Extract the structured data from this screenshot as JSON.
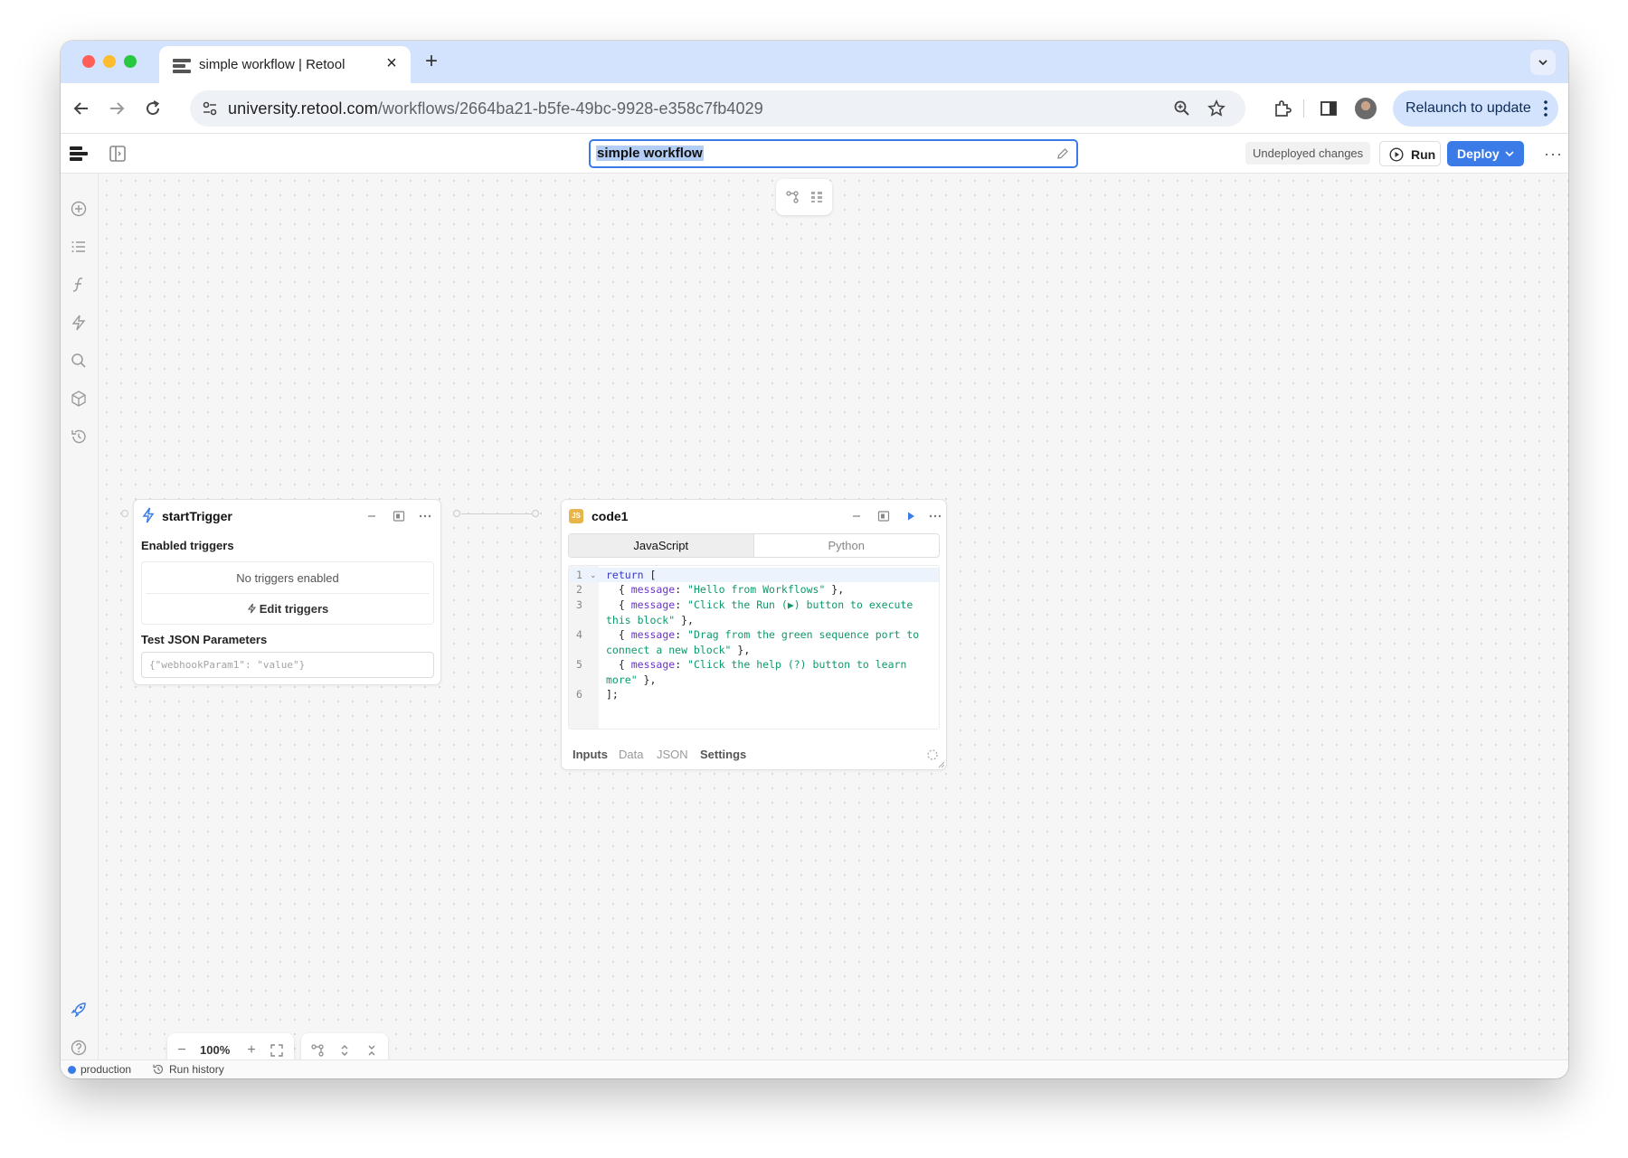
{
  "browser": {
    "tab_title": "simple workflow | Retool",
    "url_host": "university.retool.com",
    "url_path": "/workflows/2664ba21-b5fe-49bc-9928-e358c7fb4029",
    "relaunch_label": "Relaunch to update"
  },
  "header": {
    "workflow_name": "simple workflow",
    "undeployed_label": "Undeployed changes",
    "run_label": "Run",
    "deploy_label": "Deploy"
  },
  "trigger_block": {
    "title": "startTrigger",
    "enabled_triggers_label": "Enabled triggers",
    "empty_label": "No triggers enabled",
    "edit_label": "Edit triggers",
    "test_params_label": "Test JSON Parameters",
    "test_params_placeholder": "{\"webhookParam1\": \"value\"}"
  },
  "code_block": {
    "title": "code1",
    "badge": "JS",
    "languages": [
      "JavaScript",
      "Python"
    ],
    "active_language": "JavaScript",
    "line_numbers": [
      "1",
      "2",
      "3",
      "4",
      "5",
      "6"
    ],
    "code": [
      {
        "prefix": "",
        "kw": "return",
        "rest": " ["
      },
      {
        "prefix": "  { ",
        "prop": "message",
        "colon": ": ",
        "str": "\"Hello from Workflows\"",
        "end": " },"
      },
      {
        "prefix": "  { ",
        "prop": "message",
        "colon": ": ",
        "str": "\"Click the Run (▶) button to execute this block\"",
        "end": " },"
      },
      {
        "prefix": "  { ",
        "prop": "message",
        "colon": ": ",
        "str": "\"Drag from the green sequence port to connect a new block\"",
        "end": " },"
      },
      {
        "prefix": "  { ",
        "prop": "message",
        "colon": ": ",
        "str": "\"Click the help (?) button to learn more\"",
        "end": " },"
      },
      {
        "prefix": "",
        "kw": "",
        "rest": "];"
      }
    ],
    "footer_tabs": [
      "Inputs",
      "Data",
      "JSON",
      "Settings"
    ]
  },
  "zoom": {
    "level": "100%"
  },
  "status": {
    "environment": "production",
    "run_history_label": "Run history"
  },
  "colors": {
    "accent": "#3b7be8",
    "trigger_icon": "#3b7be8",
    "js_badge": "#e8b54a"
  }
}
